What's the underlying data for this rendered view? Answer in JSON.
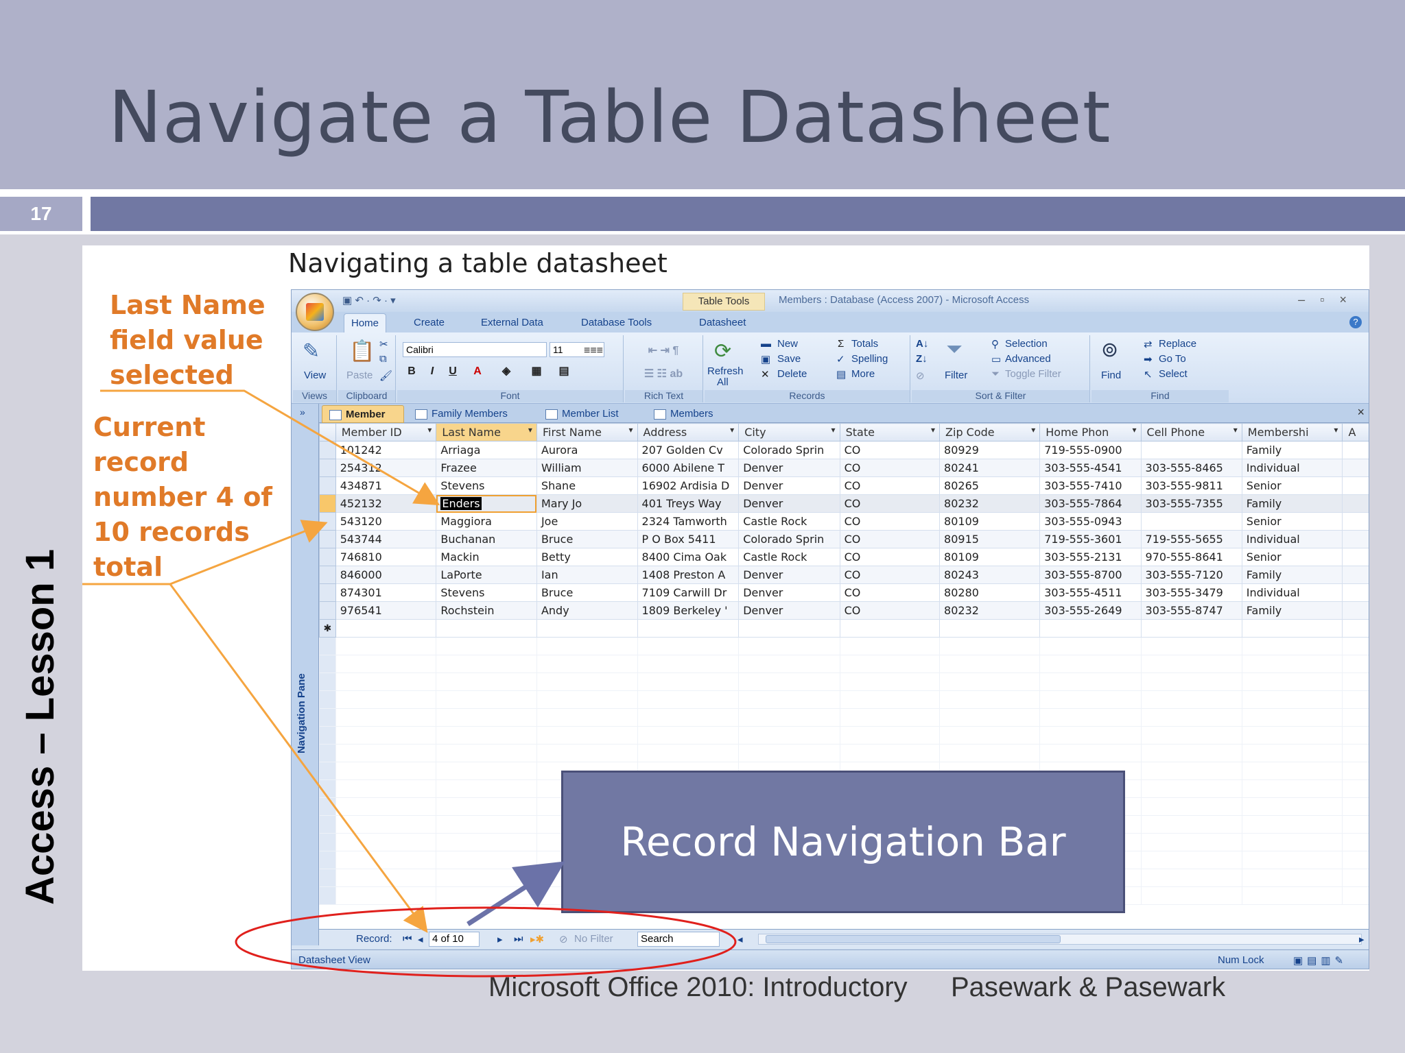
{
  "slide": {
    "title": "Navigate a Table Datasheet",
    "number": "17",
    "side_label": "Access – Lesson 1",
    "footer_left": "Microsoft Office 2010:  Introductory",
    "footer_right": "Pasewark & Pasewark"
  },
  "figure": {
    "caption": "Navigating a table datasheet",
    "callout_1": [
      "Last Name",
      "field value",
      "selected"
    ],
    "callout_2": [
      "Current",
      "record",
      "number 4 of",
      "10 records",
      "total"
    ],
    "callout_box": "Record Navigation Bar"
  },
  "access": {
    "window_title": "Members : Database (Access 2007) - Microsoft Access",
    "context_tab": "Table Tools",
    "ribbon_tabs": [
      "Home",
      "Create",
      "External Data",
      "Database Tools",
      "Datasheet"
    ],
    "groups": {
      "views": "Views",
      "clipboard": "Clipboard",
      "font": "Font",
      "rich_text": "Rich Text",
      "records": "Records",
      "sort_filter": "Sort & Filter",
      "find": "Find"
    },
    "buttons": {
      "view": "View",
      "paste": "Paste",
      "refresh": "Refresh",
      "refresh_sub": "All",
      "new": "New",
      "save": "Save",
      "delete": "Delete",
      "totals": "Totals",
      "spelling": "Spelling",
      "more": "More",
      "filter": "Filter",
      "selection": "Selection",
      "advanced": "Advanced",
      "toggle_filter": "Toggle Filter",
      "find": "Find",
      "replace": "Replace",
      "go_to": "Go To",
      "select": "Select"
    },
    "font_name": "Calibri",
    "font_size": "11",
    "nav_pane_label": "Navigation Pane",
    "object_tabs": [
      "Member",
      "Family Members",
      "Member List",
      "Members"
    ],
    "columns": [
      "Member ID",
      "Last Name",
      "First Name",
      "Address",
      "City",
      "State",
      "Zip Code",
      "Home Phon",
      "Cell Phone",
      "Membershi",
      "A"
    ],
    "rows": [
      [
        "101242",
        "Arriaga",
        "Aurora",
        "207 Golden Cv",
        "Colorado Sprin",
        "CO",
        "80929",
        "719-555-0900",
        "",
        "Family"
      ],
      [
        "254312",
        "Frazee",
        "William",
        "6000 Abilene T",
        "Denver",
        "CO",
        "80241",
        "303-555-4541",
        "303-555-8465",
        "Individual"
      ],
      [
        "434871",
        "Stevens",
        "Shane",
        "16902 Ardisia D",
        "Denver",
        "CO",
        "80265",
        "303-555-7410",
        "303-555-9811",
        "Senior"
      ],
      [
        "452132",
        "Enders",
        "Mary Jo",
        "401 Treys Way",
        "Denver",
        "CO",
        "80232",
        "303-555-7864",
        "303-555-7355",
        "Family"
      ],
      [
        "543120",
        "Maggiora",
        "Joe",
        "2324 Tamworth",
        "Castle Rock",
        "CO",
        "80109",
        "303-555-0943",
        "",
        "Senior"
      ],
      [
        "543744",
        "Buchanan",
        "Bruce",
        "P O Box 5411",
        "Colorado Sprin",
        "CO",
        "80915",
        "719-555-3601",
        "719-555-5655",
        "Individual"
      ],
      [
        "746810",
        "Mackin",
        "Betty",
        "8400 Cima Oak",
        "Castle Rock",
        "CO",
        "80109",
        "303-555-2131",
        "970-555-8641",
        "Senior"
      ],
      [
        "846000",
        "LaPorte",
        "Ian",
        "1408 Preston A",
        "Denver",
        "CO",
        "80243",
        "303-555-8700",
        "303-555-7120",
        "Family"
      ],
      [
        "874301",
        "Stevens",
        "Bruce",
        "7109 Carwill Dr",
        "Denver",
        "CO",
        "80280",
        "303-555-4511",
        "303-555-3479",
        "Individual"
      ],
      [
        "976541",
        "Rochstein",
        "Andy",
        "1809 Berkeley '",
        "Denver",
        "CO",
        "80232",
        "303-555-2649",
        "303-555-8747",
        "Family"
      ]
    ],
    "record_nav": {
      "label": "Record:",
      "position": "4 of 10",
      "filter": "No Filter",
      "search": "Search"
    },
    "status": {
      "view": "Datasheet View",
      "num_lock": "Num Lock"
    }
  }
}
